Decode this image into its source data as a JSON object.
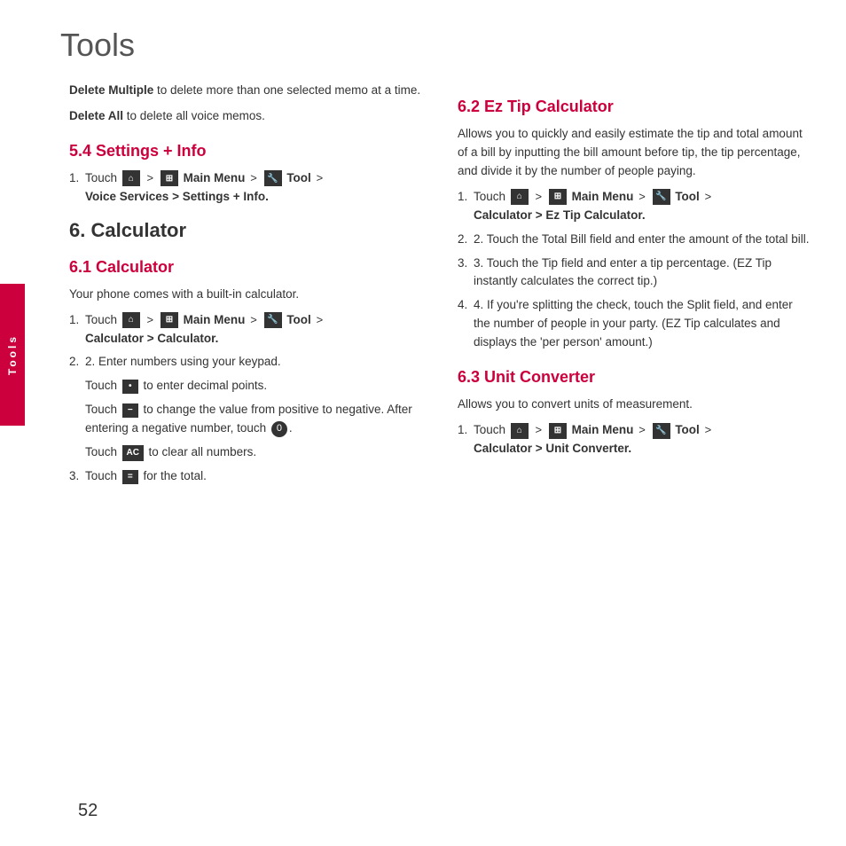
{
  "page": {
    "title": "Tools",
    "page_number": "52",
    "sidebar_label": "Tools"
  },
  "left_column": {
    "delete_multiple_text": "Delete Multiple to delete more than one selected memo at a time.",
    "delete_all_text": "Delete All to delete all voice memos.",
    "section_54": {
      "heading": "5.4 Settings + Info",
      "step1_prefix": "1. Touch",
      "step1_suffix": "> Main Menu >",
      "step1_suffix2": "Tool >",
      "step1_bold": "Voice Services > Settings + Info."
    },
    "section_6": {
      "heading": "6. Calculator"
    },
    "section_61": {
      "heading": "6.1 Calculator",
      "intro": "Your phone comes with a built-in calculator.",
      "step1_prefix": "1. Touch",
      "step1_bold": "Calculator > Calculator.",
      "step2": "2. Enter numbers using your keypad.",
      "sub1_prefix": "Touch",
      "sub1_suffix": "to enter decimal points.",
      "sub2_prefix": "Touch",
      "sub2_suffix": "to change the value from positive to negative. After entering a negative number, touch",
      "sub2_suffix2": ".",
      "sub3_prefix": "Touch",
      "sub3_suffix": "to clear all numbers.",
      "step3_prefix": "3. Touch",
      "step3_suffix": "for the total."
    }
  },
  "right_column": {
    "section_62": {
      "heading": "6.2 Ez Tip Calculator",
      "intro": "Allows you to quickly and easily estimate the tip and total amount of a bill by inputting the bill amount before tip, the tip percentage, and divide it by the number of people paying.",
      "step1_prefix": "1. Touch",
      "step1_bold": "Calculator > Ez Tip Calculator.",
      "step2": "2. Touch the Total Bill field and enter the amount of the total bill.",
      "step3": "3. Touch the Tip field and enter a tip percentage. (EZ Tip instantly calculates the correct tip.)",
      "step4": "4. If you're splitting the check, touch the Split field, and enter the number of people in your party. (EZ Tip calculates and displays the 'per person' amount.)"
    },
    "section_63": {
      "heading": "6.3 Unit Converter",
      "intro": "Allows you to convert units of measurement.",
      "step1_prefix": "1. Touch",
      "step1_bold": "Calculator > Unit Converter."
    }
  },
  "icons": {
    "home": "⌂",
    "main_menu": "⊞",
    "tool": "✦",
    "dot": "•",
    "minus": "−",
    "zero": "0",
    "ac": "AC",
    "equals": "="
  }
}
